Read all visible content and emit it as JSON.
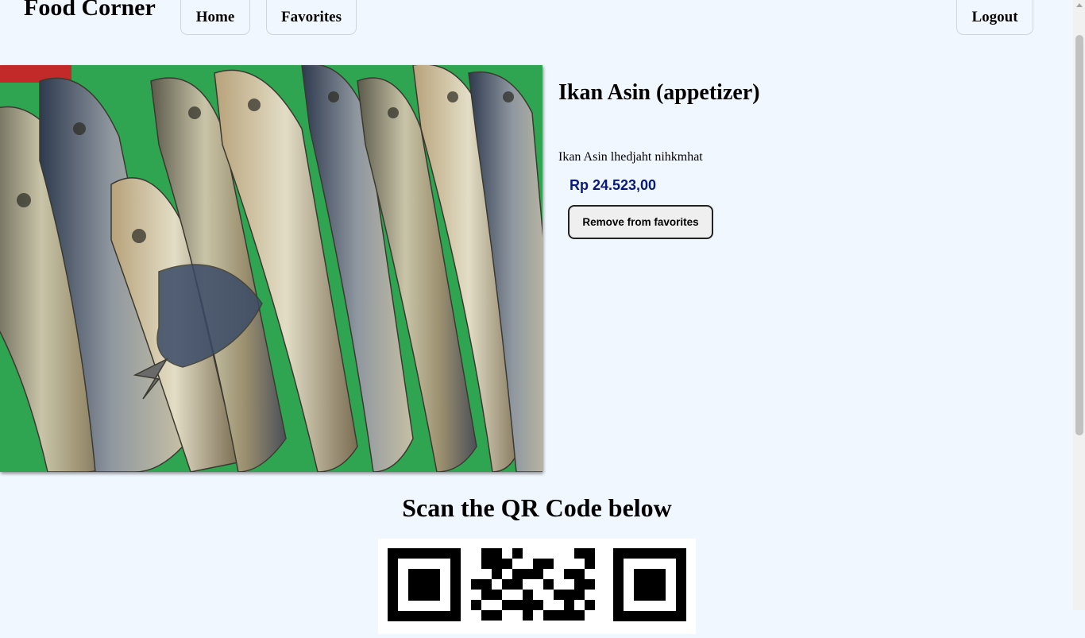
{
  "header": {
    "brand": "Food Corner",
    "nav": {
      "home": "Home",
      "favorites": "Favorites",
      "logout": "Logout"
    }
  },
  "product": {
    "image_icon": "dried-fish-photo",
    "title": "Ikan Asin (appetizer)",
    "description": "Ikan Asin lhedjaht nihkmhat",
    "price": "Rp 24.523,00",
    "remove_label": "Remove from favorites"
  },
  "qr": {
    "heading": "Scan the QR Code below",
    "icon": "qr-code-icon"
  },
  "colors": {
    "background": "#f0f7ff",
    "price": "#0a1a7a",
    "photo_tray": "#2aa84a"
  }
}
